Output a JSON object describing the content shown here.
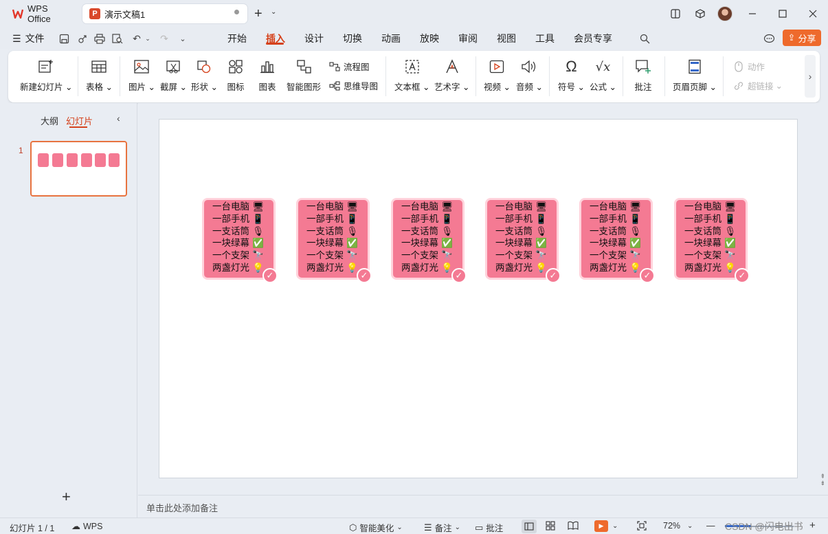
{
  "titlebar": {
    "home_tab": "WPS Office",
    "doc_tab": "演示文稿1"
  },
  "menu": {
    "file": "文件",
    "tabs": [
      "开始",
      "插入",
      "设计",
      "切换",
      "动画",
      "放映",
      "审阅",
      "视图",
      "工具",
      "会员专享"
    ],
    "active_tab": "插入",
    "share": "分享"
  },
  "ribbon": {
    "new_slide": "新建幻灯片",
    "table": "表格",
    "picture": "图片",
    "screenshot": "截屏",
    "shape": "形状",
    "icon": "图标",
    "chart": "图表",
    "smart_graphic": "智能图形",
    "flowchart": "流程图",
    "mindmap": "思维导图",
    "textbox": "文本框",
    "wordart": "艺术字",
    "video": "视频",
    "audio": "音频",
    "symbol": "符号",
    "formula": "公式",
    "comment": "批注",
    "header_footer": "页眉页脚",
    "action": "动作",
    "hyperlink": "超链接"
  },
  "left_panel": {
    "outline_tab": "大纲",
    "slides_tab": "幻灯片",
    "slide_number": "1"
  },
  "slide": {
    "cards": [
      [
        "一台电脑 🖥",
        "一部手机 📱",
        "一支话筒 🎙",
        "一块绿幕 ✅",
        "一个支架 🔭",
        "两盏灯光 💡"
      ],
      [
        "一台电脑 🖥",
        "一部手机 📱",
        "一支话筒 🎙",
        "一块绿幕 ✅",
        "一个支架 🔭",
        "两盏灯光 💡"
      ],
      [
        "一台电脑 🖥",
        "一部手机 📱",
        "一支话筒 🎙",
        "一块绿幕 ✅",
        "一个支架 🔭",
        "两盏灯光 💡"
      ],
      [
        "一台电脑 🖥",
        "一部手机 📱",
        "一支话筒 🎙",
        "一块绿幕 ✅",
        "一个支架 🔭",
        "两盏灯光 💡"
      ],
      [
        "一台电脑 🖥",
        "一部手机 📱",
        "一支话筒 🎙",
        "一块绿幕 ✅",
        "一个支架 🔭",
        "两盏灯光 💡"
      ],
      [
        "一台电脑 🖥",
        "一部手机 📱",
        "一支话筒 🎙",
        "一块绿幕 ✅",
        "一个支架 🔭",
        "两盏灯光 💡"
      ]
    ],
    "card_color": "#f47a93"
  },
  "notes": {
    "placeholder": "单击此处添加备注"
  },
  "status": {
    "slide_counter": "幻灯片 1 / 1",
    "wps_label": "WPS",
    "smart_beautify": "智能美化",
    "notes": "备注",
    "comment": "批注",
    "zoom": "72%",
    "watermark": "CSDN @闪电出书"
  },
  "colors": {
    "accent": "#d5411b",
    "share": "#ee6a2c"
  }
}
